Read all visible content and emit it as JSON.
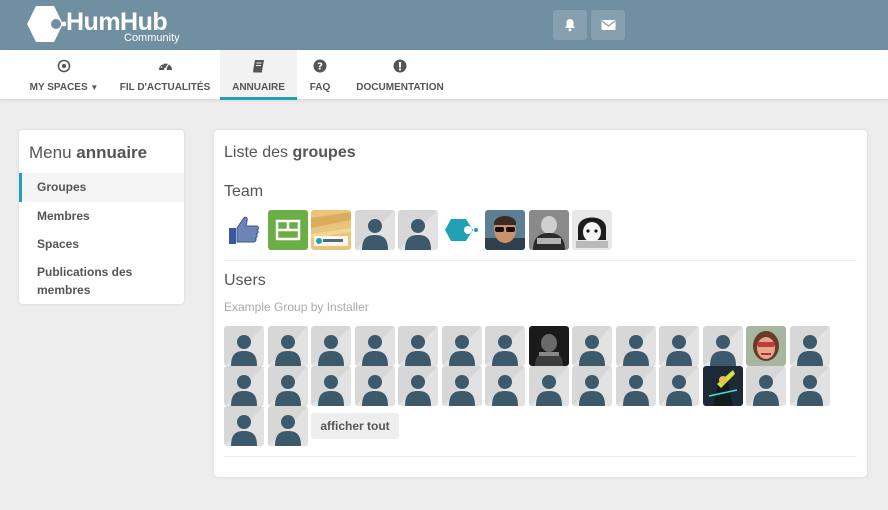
{
  "app": {
    "logo_text": "HumHub",
    "logo_sub": "Community",
    "brand_color": "#708fa0",
    "accent_color": "#21a1b3"
  },
  "topbar": {
    "notifications_icon": "bell-icon",
    "messages_icon": "envelope-icon"
  },
  "nav": {
    "items": [
      {
        "label": "MY SPACES",
        "icon": "dot-circle-icon",
        "dropdown": true
      },
      {
        "label": "FIL D'ACTUALITÉS",
        "icon": "dashboard-icon"
      },
      {
        "label": "ANNUAIRE",
        "icon": "book-icon",
        "active": true
      },
      {
        "label": "FAQ",
        "icon": "question-circle-icon"
      },
      {
        "label": "DOCUMENTATION",
        "icon": "exclamation-circle-icon"
      }
    ]
  },
  "sidebar": {
    "title_prefix": "Menu",
    "title_bold": "annuaire",
    "items": [
      {
        "label": "Groupes",
        "active": true
      },
      {
        "label": "Membres"
      },
      {
        "label": "Spaces"
      },
      {
        "label": "Publications des membres"
      }
    ]
  },
  "main": {
    "title_prefix": "Liste des",
    "title_bold": "groupes",
    "groups": [
      {
        "name": "Team",
        "description": "",
        "members": [
          "like",
          "green",
          "wood",
          "default",
          "default",
          "logo",
          "photo-glasses",
          "photo-mono",
          "photo-cartoon"
        ]
      },
      {
        "name": "Users",
        "description": "Example Group by Installer",
        "members": [
          "default",
          "default",
          "default",
          "default",
          "default",
          "default",
          "default",
          "photo-dark",
          "default",
          "default",
          "default",
          "default",
          "photo-woman",
          "default",
          "default",
          "default",
          "default",
          "default",
          "default",
          "default",
          "default",
          "default",
          "default",
          "default",
          "default",
          "photo-neon",
          "default",
          "default",
          "default",
          "default"
        ],
        "show_all_label": "afficher tout"
      }
    ]
  }
}
